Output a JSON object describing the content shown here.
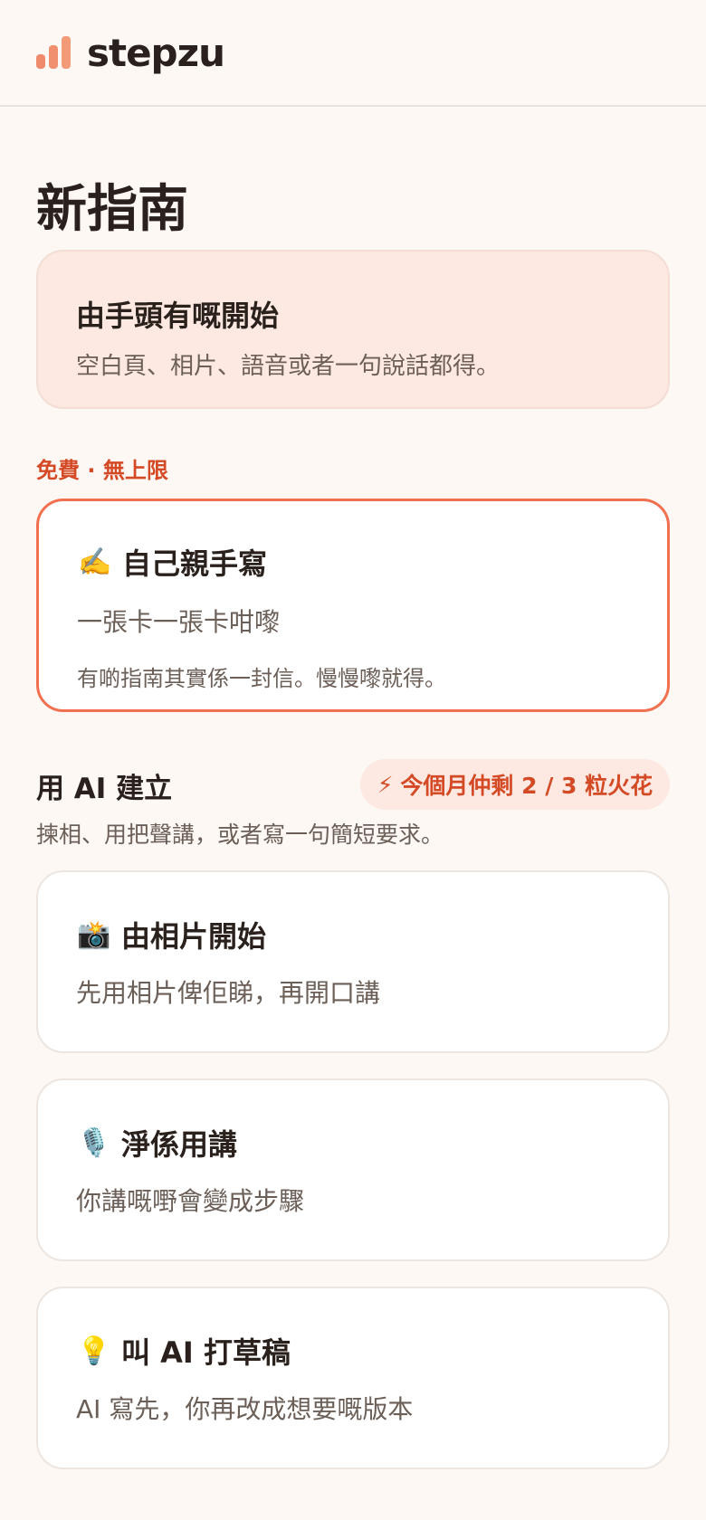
{
  "brand": {
    "name": "stepzu"
  },
  "page": {
    "title": "新指南"
  },
  "start_card": {
    "title": "由手頭有嘅開始",
    "subtitle": "空白頁、相片、語音或者一句說話都得。"
  },
  "free_section": {
    "label": "免費 · 無上限"
  },
  "manual_card": {
    "icon": "✍️",
    "title": "自己親手寫",
    "subtitle": "一張卡一張卡咁嚟",
    "description": "有啲指南其實係一封信。慢慢嚟就得。"
  },
  "ai_section": {
    "title": "用 AI 建立",
    "subtitle": "揀相、用把聲講，或者寫一句簡短要求。",
    "spark_icon": "⚡",
    "spark_label": "今個月仲剩 2 / 3 粒火花"
  },
  "ai_cards": [
    {
      "icon": "📸",
      "title": "由相片開始",
      "subtitle": "先用相片俾佢睇，再開口講"
    },
    {
      "icon": "🎙️",
      "title": "淨係用講",
      "subtitle": "你講嘅嘢會變成步驟"
    },
    {
      "icon": "💡",
      "title": "叫 AI 打草稿",
      "subtitle": "AI 寫先，你再改成想要嘅版本"
    }
  ],
  "colors": {
    "accent": "#f2704f",
    "accent_text": "#d44a26",
    "soft_peach": "#fde9e1",
    "background": "#fdf8f4"
  }
}
